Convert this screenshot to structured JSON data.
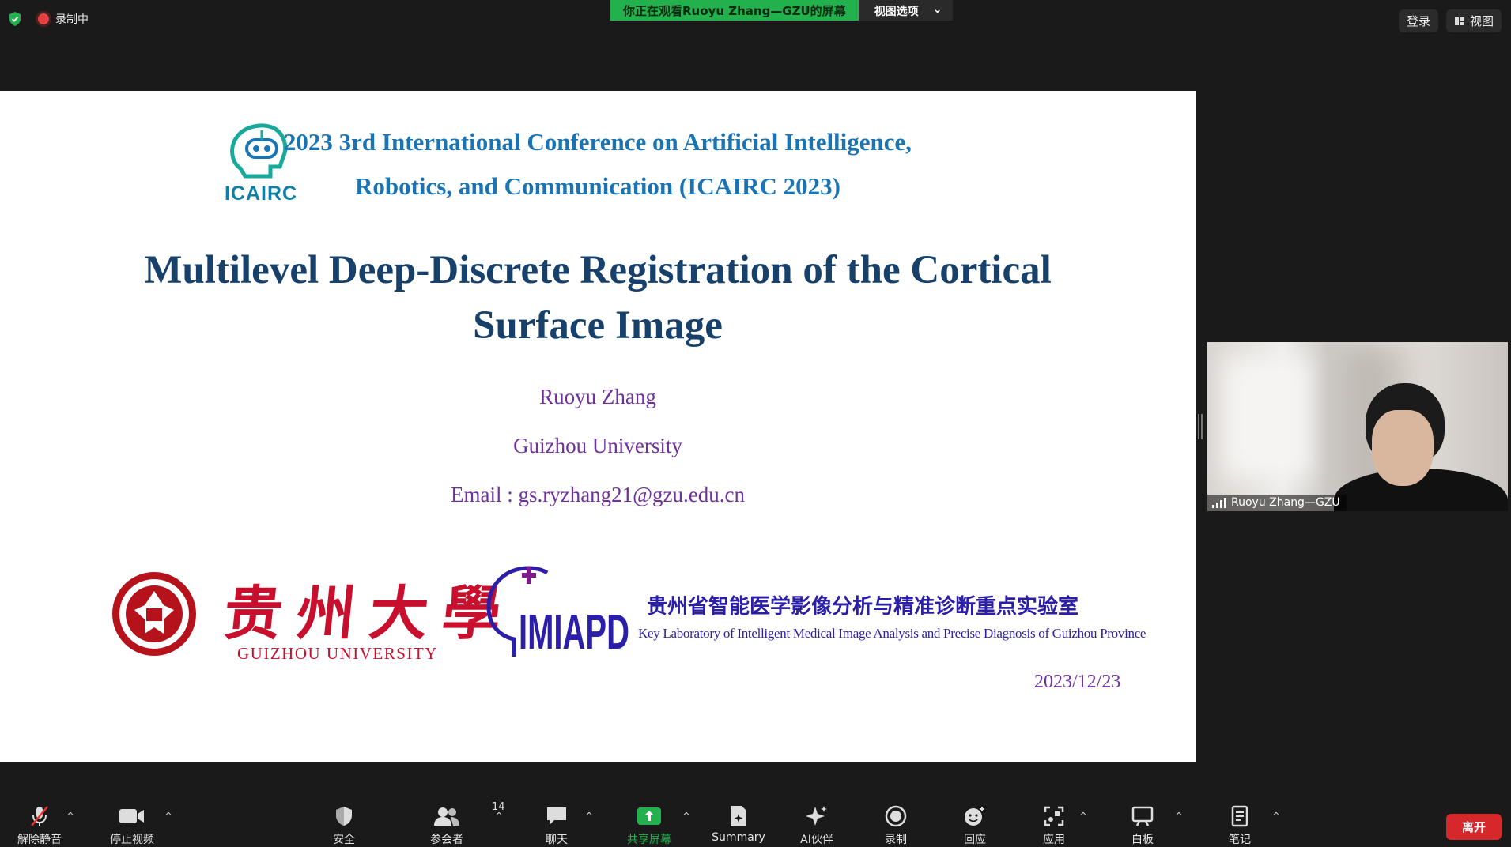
{
  "topbar": {
    "recording_label": "录制中",
    "viewing_banner": "你正在观看Ruoyu  Zhang—GZU的屏幕",
    "view_options_label": "视图选项",
    "login_label": "登录",
    "view_label": "视图"
  },
  "slide": {
    "conf_logo_text": "ICAIRC",
    "conference_line1": "2023 3rd International Conference on Artificial Intelligence,",
    "conference_line2": "Robotics, and Communication (ICAIRC 2023)",
    "title_line1": "Multilevel Deep-Discrete Registration of the Cortical",
    "title_line2": "Surface Image",
    "author": "Ruoyu Zhang",
    "affiliation": "Guizhou University",
    "email": "Email : gs.ryzhang21@gzu.edu.cn",
    "university_seal_text": "贵州大学 GUIZHOU UNIVERSITY 1902",
    "university_cn": "贵州大學",
    "university_en": "GUIZHOU UNIVERSITY",
    "lab_logo_text": "IMIAPD",
    "lab_cn": "贵州省智能医学影像分析与精准诊断重点实验室",
    "lab_en": "Key Laboratory of Intelligent Medical Image Analysis and Precise Diagnosis of Guizhou Province",
    "date": "2023/12/23"
  },
  "video": {
    "participant_name": "Ruoyu Zhang—GZU"
  },
  "toolbar": {
    "unmute": "解除静音",
    "stop_video": "停止视频",
    "security": "安全",
    "participants": "参会者",
    "participants_count": "14",
    "chat": "聊天",
    "share_screen": "共享屏幕",
    "summary": "Summary",
    "ai_companion": "AI伙伴",
    "record": "录制",
    "reactions": "回应",
    "apps": "应用",
    "whiteboard": "白板",
    "notes": "笔记",
    "leave": "离开"
  },
  "colors": {
    "share_green": "#22b14c",
    "leave_red": "#d6282a",
    "title_navy": "#17406a",
    "accent_purple": "#7030a0"
  }
}
